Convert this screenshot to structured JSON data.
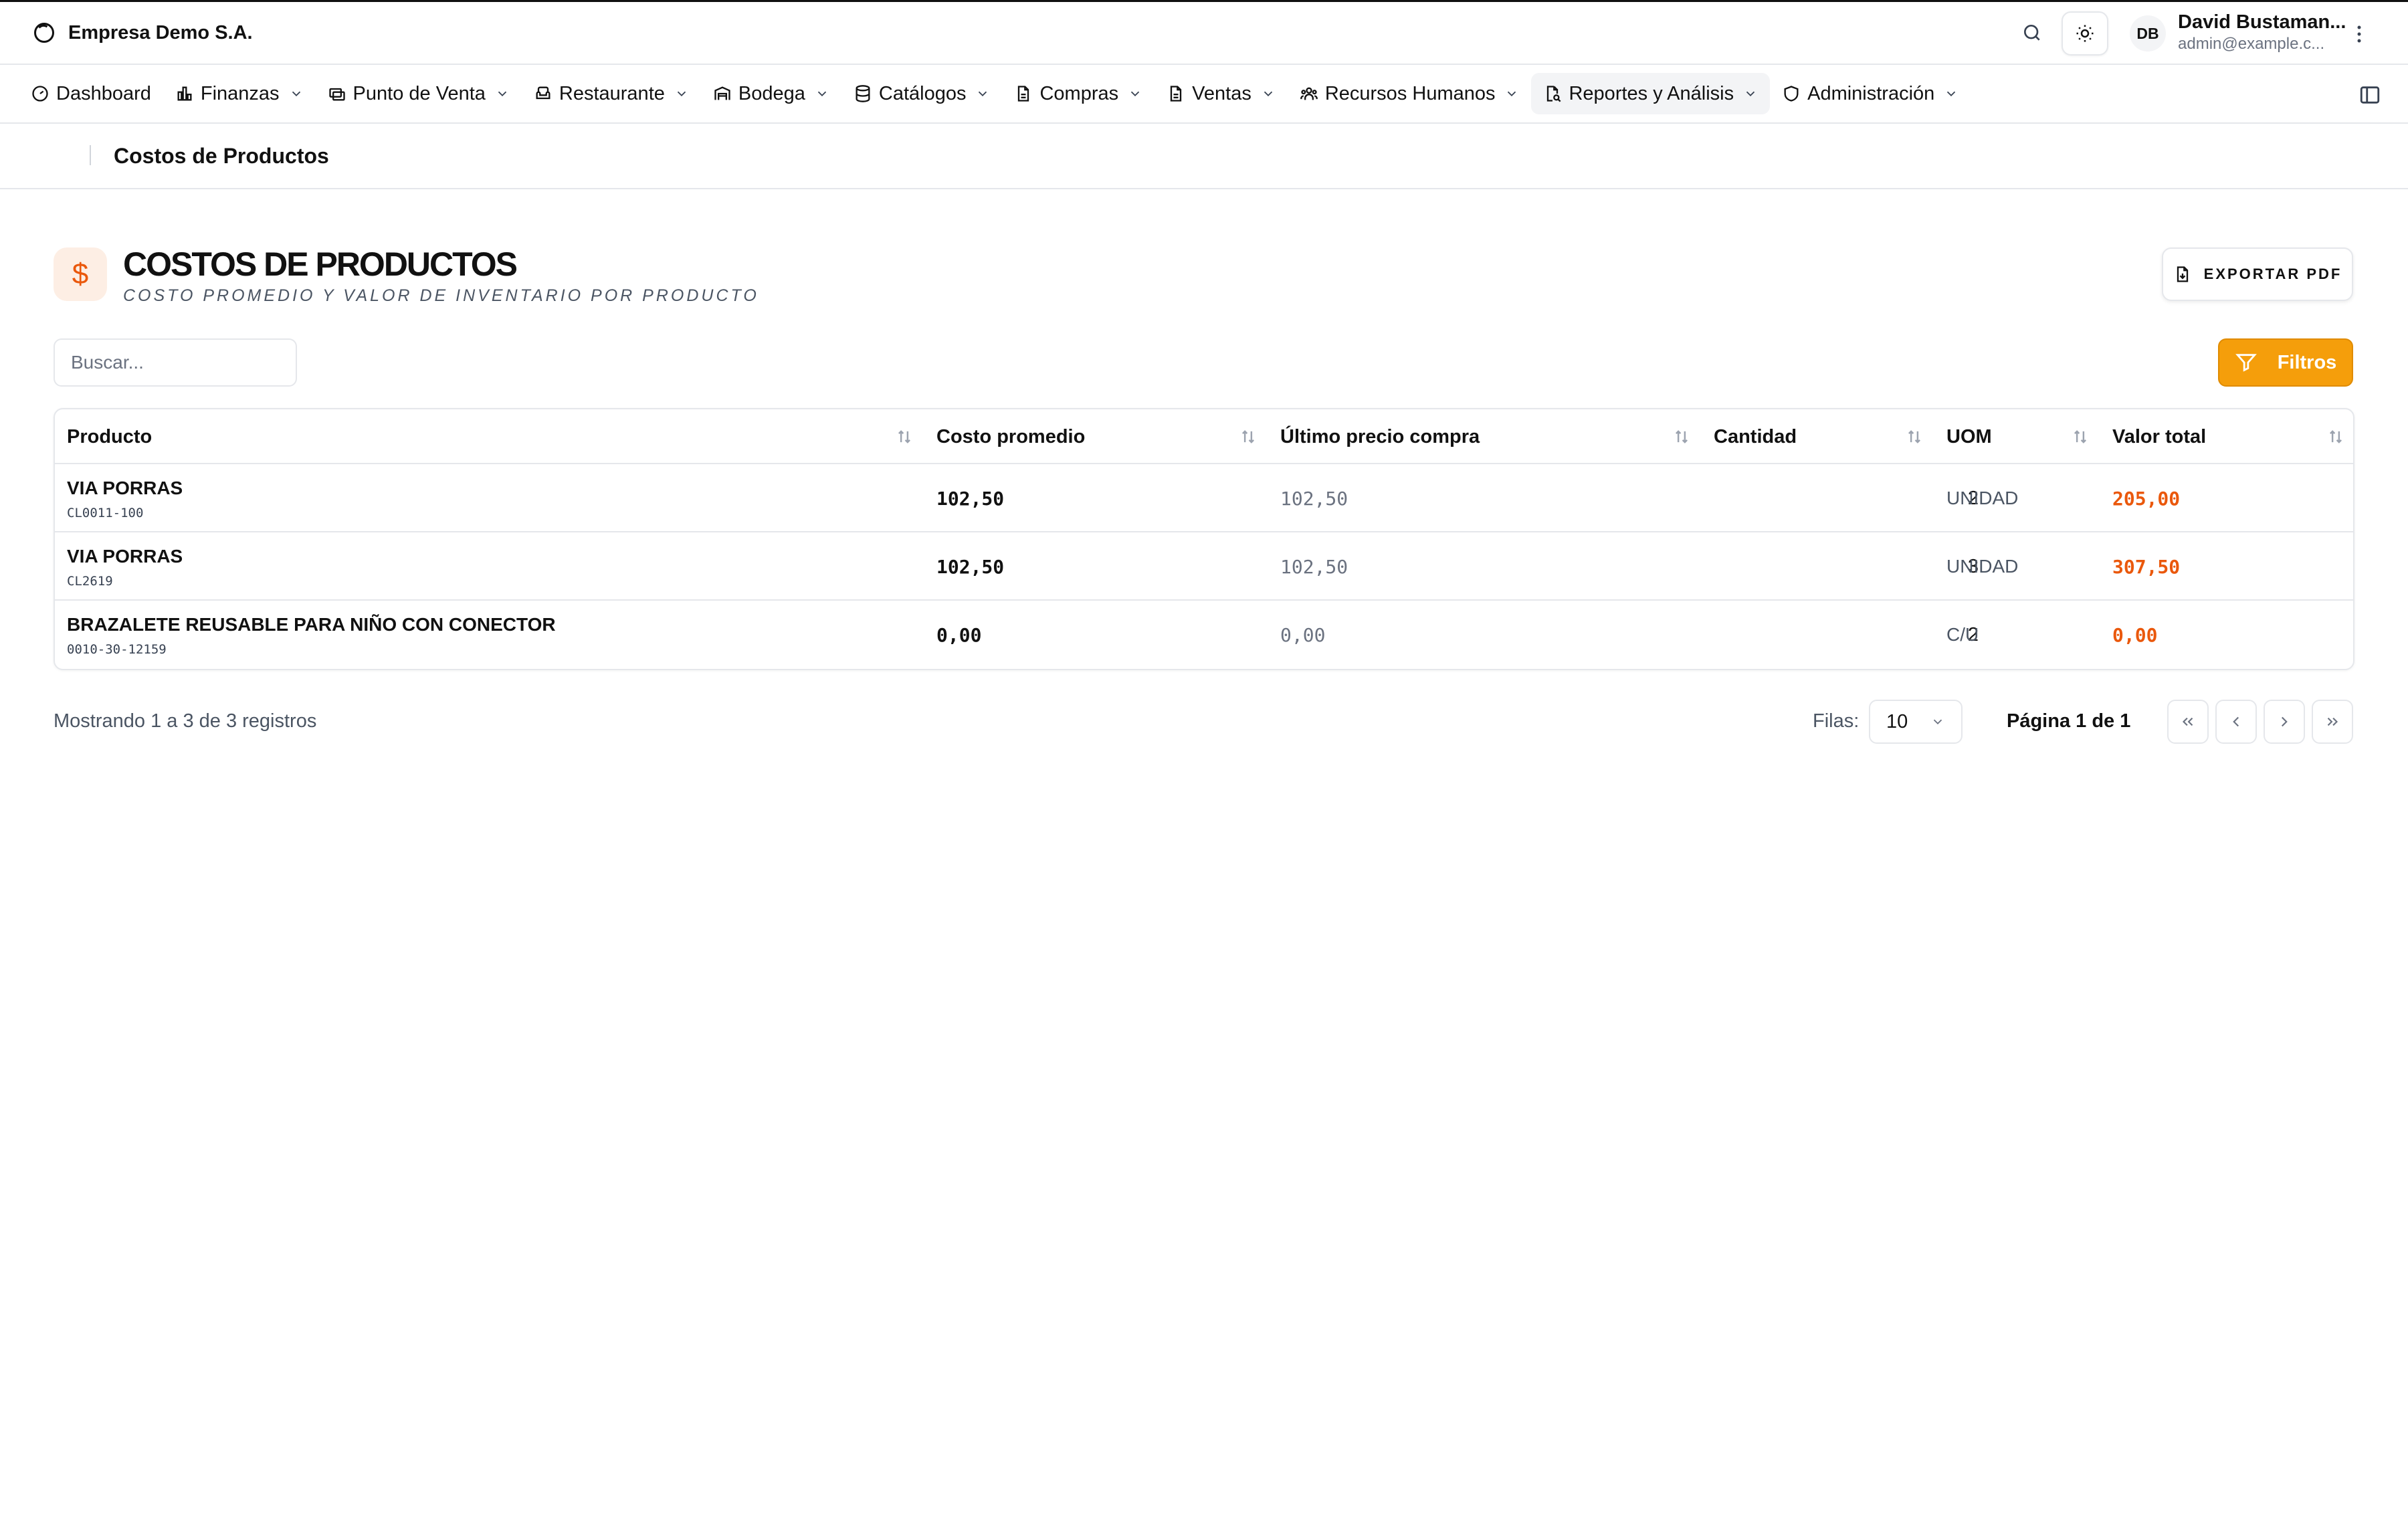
{
  "header": {
    "company": "Empresa Demo S.A.",
    "user_initials": "DB",
    "user_name": "David Bustaman...",
    "user_email": "admin@example.c..."
  },
  "nav": {
    "items": [
      {
        "label": "Dashboard",
        "icon": "gauge-icon"
      },
      {
        "label": "Finanzas",
        "icon": "bar-chart-icon"
      },
      {
        "label": "Punto de Venta",
        "icon": "register-icon"
      },
      {
        "label": "Restaurante",
        "icon": "armchair-icon"
      },
      {
        "label": "Bodega",
        "icon": "warehouse-icon"
      },
      {
        "label": "Catálogos",
        "icon": "database-icon"
      },
      {
        "label": "Compras",
        "icon": "document-icon"
      },
      {
        "label": "Ventas",
        "icon": "document-icon"
      },
      {
        "label": "Recursos Humanos",
        "icon": "users-icon"
      },
      {
        "label": "Reportes y Análisis",
        "icon": "file-chart-icon"
      },
      {
        "label": "Administración",
        "icon": "shield-icon"
      }
    ]
  },
  "breadcrumb": {
    "current": "Costos de Productos"
  },
  "page": {
    "title": "COSTOS DE PRODUCTOS",
    "subtitle": "Costo promedio y valor de inventario por producto",
    "export_label": "EXPORTAR PDF",
    "search_placeholder": "Buscar...",
    "filters_label": "Filtros",
    "icon_glyph": "$"
  },
  "table": {
    "columns": [
      "Producto",
      "Costo promedio",
      "Último precio compra",
      "Cantidad",
      "UOM",
      "Valor total"
    ],
    "rows": [
      {
        "name": "VIA PORRAS",
        "code": "CL0011-100",
        "avg_cost": "102,50",
        "last_price": "102,50",
        "qty": "2",
        "uom": "UNIDAD",
        "total": "205,00"
      },
      {
        "name": "VIA PORRAS",
        "code": "CL2619",
        "avg_cost": "102,50",
        "last_price": "102,50",
        "qty": "3",
        "uom": "UNIDAD",
        "total": "307,50"
      },
      {
        "name": "BRAZALETE REUSABLE PARA NIÑO CON CONECTOR",
        "code": "0010-30-12159",
        "avg_cost": "0,00",
        "last_price": "0,00",
        "qty": "2",
        "uom": "C/U",
        "total": "0,00"
      }
    ]
  },
  "footer": {
    "showing": "Mostrando 1 a 3 de 3 registros",
    "rows_label": "Filas:",
    "rows_value": "10",
    "page_info": "Página 1 de 1"
  },
  "colors": {
    "accent": "#f59e0b",
    "value_orange": "#ea580c",
    "border": "#e5e7eb"
  }
}
